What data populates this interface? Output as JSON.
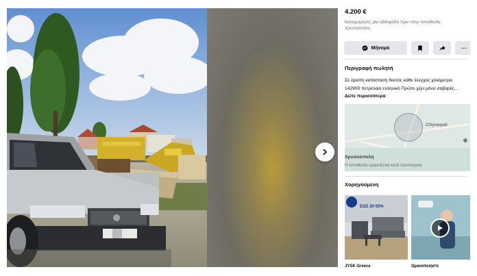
{
  "listing": {
    "price": "4.200 €",
    "posted": "Καταχώρηση: μία εβδομάδα πριν στην τοποθεσία Χρυσούπολη"
  },
  "actions": {
    "message_label": "Μήνυμα",
    "message_icon": "messenger-icon",
    "save_icon": "bookmark-icon",
    "share_icon": "share-icon",
    "more_label": "···"
  },
  "description": {
    "heading": "Περιγραφή πωλητή",
    "text": "Σε άριστη κατάσταση δεκτός κάθε έλεγχος χιλιόμετρα 142900 πετρέλαιο ελληνικό Πρώτο χέρι μόνο σοβαρές...",
    "see_more": "Δείτε περισσότερα"
  },
  "map": {
    "city_label": "Chrysoupoli",
    "location_title": "Χρυσούπολη",
    "location_note": "Η τοποθεσία εμφανίζεται κατά προσέγγιση"
  },
  "sponsored": {
    "heading": "Χορηγούμενη",
    "ads": [
      {
        "name": "JYSK Greece",
        "banner": "ΕΩΣ 20-50%"
      },
      {
        "name": "Ωραιοποιήστε"
      }
    ]
  },
  "viewer": {
    "next_icon": "chevron-right-icon"
  },
  "colors": {
    "button_bg": "#e4e6eb",
    "text_primary": "#050505",
    "text_secondary": "#65676b",
    "jysk_blue": "#143c8c"
  }
}
